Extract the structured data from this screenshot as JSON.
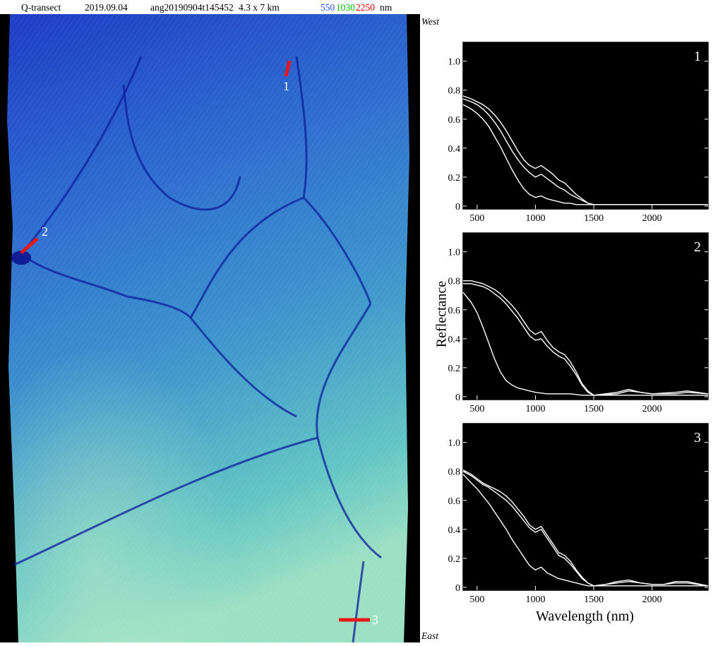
{
  "header": {
    "transect": "Q-transect",
    "date": "2019.09.04",
    "scene_id": "ang20190904t145452",
    "size": "4.3 x 7 km",
    "bands": [
      {
        "label": "550",
        "color": "#1e50ff"
      },
      {
        "label": "1030",
        "color": "#00c000"
      },
      {
        "label": "2250",
        "color": "#e00000"
      }
    ],
    "unit": "nm"
  },
  "image": {
    "label_top": "West",
    "label_bottom": "East",
    "markers": [
      {
        "label": "1",
        "color": "#e81818"
      },
      {
        "label": "2",
        "color": "#e81818"
      },
      {
        "label": "3",
        "color": "#e81818"
      }
    ]
  },
  "shared_ylabel": "Reflectance",
  "shared_xlabel": "Wavelength (nm)",
  "chart_data": [
    {
      "type": "line",
      "label": "1",
      "xlim": [
        380,
        2480
      ],
      "ylim": [
        -0.02,
        1.13
      ],
      "xticks": [
        500,
        1000,
        1500,
        2000
      ],
      "yticks": [
        0,
        0.2,
        0.4,
        0.6,
        0.8,
        1.0
      ],
      "ytick_labels": [
        "0",
        "0.2",
        "0.4",
        "0.6",
        "0.8",
        "1.0"
      ],
      "series": [
        {
          "x": [
            380,
            450,
            500,
            550,
            600,
            650,
            700,
            750,
            800,
            850,
            900,
            950,
            1000,
            1050,
            1100,
            1150,
            1200,
            1250,
            1300,
            1350,
            1400,
            1450,
            1500,
            2480
          ],
          "y": [
            0.76,
            0.74,
            0.72,
            0.7,
            0.67,
            0.63,
            0.58,
            0.52,
            0.45,
            0.38,
            0.32,
            0.28,
            0.26,
            0.28,
            0.25,
            0.22,
            0.18,
            0.16,
            0.12,
            0.08,
            0.05,
            0.02,
            0.01,
            0.01
          ]
        },
        {
          "x": [
            380,
            450,
            500,
            550,
            600,
            650,
            700,
            750,
            800,
            850,
            900,
            950,
            1000,
            1050,
            1100,
            1150,
            1200,
            1250,
            1300,
            1350,
            1400,
            1450,
            1500,
            2480
          ],
          "y": [
            0.74,
            0.72,
            0.7,
            0.67,
            0.63,
            0.58,
            0.52,
            0.45,
            0.38,
            0.32,
            0.27,
            0.23,
            0.2,
            0.22,
            0.19,
            0.16,
            0.13,
            0.11,
            0.08,
            0.06,
            0.04,
            0.02,
            0.01,
            0.01
          ]
        },
        {
          "x": [
            380,
            450,
            500,
            550,
            600,
            650,
            700,
            750,
            800,
            850,
            900,
            950,
            1000,
            1050,
            1100,
            1150,
            1200,
            1250,
            1300,
            1350,
            1400,
            1450,
            1500,
            2480
          ],
          "y": [
            0.7,
            0.67,
            0.64,
            0.6,
            0.55,
            0.48,
            0.41,
            0.33,
            0.25,
            0.18,
            0.12,
            0.08,
            0.06,
            0.07,
            0.05,
            0.04,
            0.03,
            0.02,
            0.02,
            0.01,
            0.01,
            0.01,
            0.01,
            0.01
          ]
        }
      ]
    },
    {
      "type": "line",
      "label": "2",
      "xlim": [
        380,
        2480
      ],
      "ylim": [
        -0.02,
        1.13
      ],
      "xticks": [
        500,
        1000,
        1500,
        2000
      ],
      "yticks": [
        0,
        0.2,
        0.4,
        0.6,
        0.8,
        1.0
      ],
      "ytick_labels": [
        "0",
        "0.2",
        "0.4",
        "0.6",
        "0.8",
        "1.0"
      ],
      "series": [
        {
          "x": [
            380,
            450,
            500,
            550,
            600,
            650,
            700,
            750,
            800,
            850,
            900,
            950,
            1000,
            1050,
            1100,
            1150,
            1200,
            1250,
            1300,
            1350,
            1400,
            1450,
            1500,
            1700,
            1800,
            1900,
            2000,
            2200,
            2300,
            2480
          ],
          "y": [
            0.8,
            0.8,
            0.79,
            0.78,
            0.76,
            0.74,
            0.71,
            0.67,
            0.63,
            0.58,
            0.52,
            0.46,
            0.43,
            0.45,
            0.39,
            0.34,
            0.31,
            0.29,
            0.24,
            0.17,
            0.09,
            0.04,
            0.01,
            0.03,
            0.05,
            0.03,
            0.02,
            0.03,
            0.04,
            0.02
          ]
        },
        {
          "x": [
            380,
            450,
            500,
            550,
            600,
            650,
            700,
            750,
            800,
            850,
            900,
            950,
            1000,
            1050,
            1100,
            1150,
            1200,
            1250,
            1300,
            1350,
            1400,
            1450,
            1500,
            1700,
            1800,
            1900,
            2000,
            2200,
            2300,
            2480
          ],
          "y": [
            0.78,
            0.78,
            0.77,
            0.76,
            0.74,
            0.71,
            0.68,
            0.64,
            0.59,
            0.54,
            0.48,
            0.42,
            0.39,
            0.4,
            0.35,
            0.31,
            0.28,
            0.26,
            0.21,
            0.15,
            0.08,
            0.03,
            0.01,
            0.02,
            0.04,
            0.03,
            0.02,
            0.02,
            0.03,
            0.02
          ]
        },
        {
          "x": [
            380,
            450,
            500,
            550,
            600,
            650,
            700,
            750,
            800,
            850,
            900,
            950,
            1000,
            1100,
            1200,
            1300,
            1400,
            1500,
            2480
          ],
          "y": [
            0.72,
            0.65,
            0.58,
            0.48,
            0.37,
            0.26,
            0.17,
            0.11,
            0.08,
            0.06,
            0.05,
            0.04,
            0.03,
            0.02,
            0.02,
            0.02,
            0.01,
            0.01,
            0.01
          ]
        }
      ]
    },
    {
      "type": "line",
      "label": "3",
      "xlim": [
        380,
        2480
      ],
      "ylim": [
        -0.02,
        1.13
      ],
      "xticks": [
        500,
        1000,
        1500,
        2000
      ],
      "yticks": [
        0,
        0.2,
        0.4,
        0.6,
        0.8,
        1.0
      ],
      "ytick_labels": [
        "0",
        "0.2",
        "0.4",
        "0.6",
        "0.8",
        "1.0"
      ],
      "series": [
        {
          "x": [
            380,
            450,
            500,
            550,
            600,
            650,
            700,
            750,
            800,
            850,
            900,
            950,
            1000,
            1050,
            1100,
            1150,
            1200,
            1250,
            1300,
            1350,
            1400,
            1450,
            1500,
            1600,
            1700,
            1800,
            1900,
            2000,
            2100,
            2200,
            2300,
            2480
          ],
          "y": [
            0.81,
            0.78,
            0.75,
            0.72,
            0.7,
            0.68,
            0.66,
            0.63,
            0.59,
            0.54,
            0.49,
            0.43,
            0.4,
            0.42,
            0.36,
            0.3,
            0.24,
            0.22,
            0.18,
            0.12,
            0.07,
            0.03,
            0.01,
            0.02,
            0.04,
            0.05,
            0.03,
            0.02,
            0.02,
            0.04,
            0.04,
            0.01
          ]
        },
        {
          "x": [
            380,
            450,
            500,
            550,
            600,
            650,
            700,
            750,
            800,
            850,
            900,
            950,
            1000,
            1050,
            1100,
            1150,
            1200,
            1250,
            1300,
            1350,
            1400,
            1450,
            1500,
            1600,
            1700,
            1800,
            1900,
            2000,
            2100,
            2200,
            2300,
            2480
          ],
          "y": [
            0.8,
            0.77,
            0.74,
            0.71,
            0.69,
            0.66,
            0.63,
            0.6,
            0.56,
            0.51,
            0.46,
            0.41,
            0.38,
            0.4,
            0.34,
            0.28,
            0.22,
            0.2,
            0.16,
            0.11,
            0.06,
            0.03,
            0.01,
            0.02,
            0.03,
            0.04,
            0.03,
            0.02,
            0.02,
            0.03,
            0.03,
            0.01
          ]
        },
        {
          "x": [
            380,
            450,
            500,
            550,
            600,
            650,
            700,
            750,
            800,
            850,
            900,
            950,
            1000,
            1050,
            1100,
            1150,
            1200,
            1250,
            1300,
            1350,
            1400,
            1450,
            1500,
            2480
          ],
          "y": [
            0.78,
            0.72,
            0.68,
            0.63,
            0.58,
            0.52,
            0.46,
            0.4,
            0.33,
            0.27,
            0.21,
            0.15,
            0.12,
            0.14,
            0.1,
            0.08,
            0.06,
            0.05,
            0.04,
            0.03,
            0.02,
            0.01,
            0.01,
            0.01
          ]
        }
      ]
    }
  ]
}
